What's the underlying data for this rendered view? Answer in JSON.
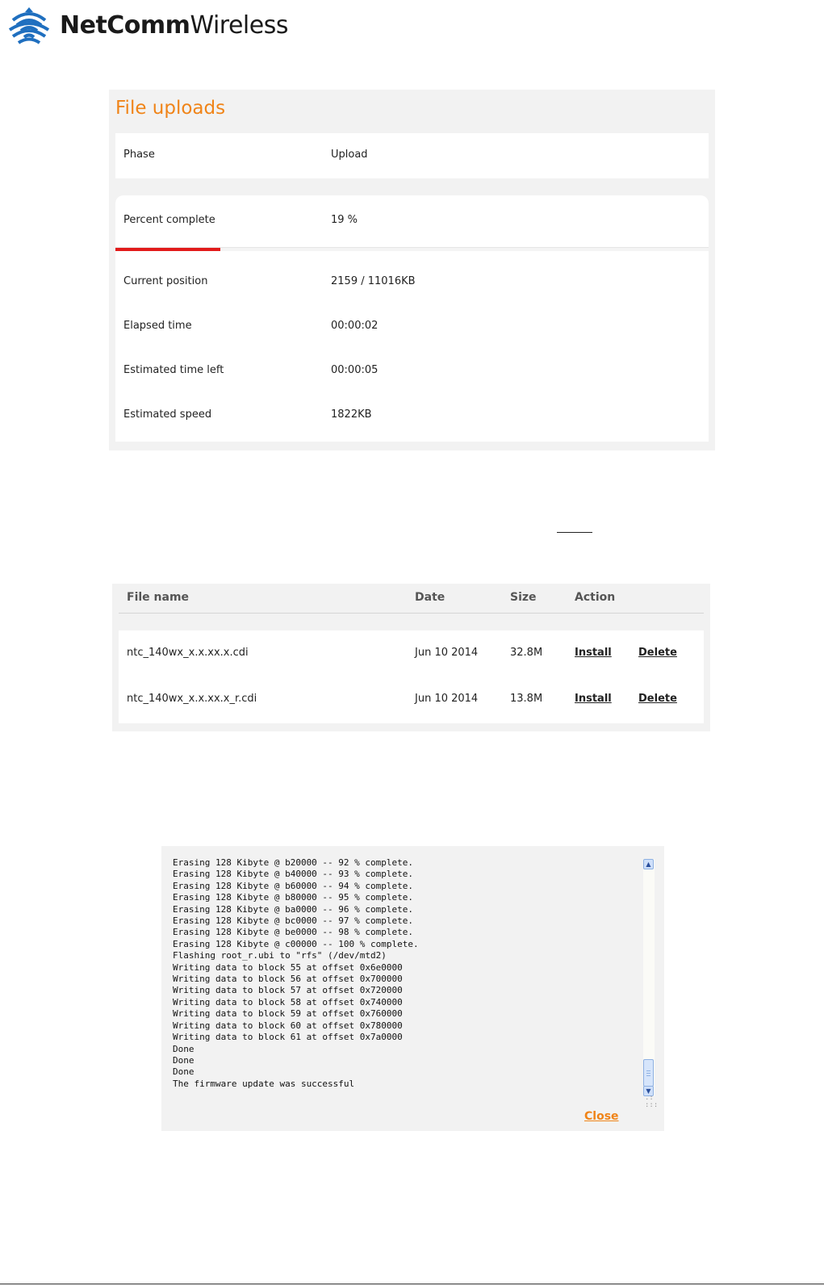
{
  "brand": {
    "logo_bold": "NetComm",
    "logo_light": "Wireless",
    "accent_color": "#f08418",
    "progress_color": "#e21b1b"
  },
  "upload": {
    "title": "File uploads",
    "phase_label": "Phase",
    "phase_value": "Upload",
    "percent_label": "Percent complete",
    "percent_value": "19 %",
    "percent_fraction": 0.19,
    "position_label": "Current position",
    "position_value": "2159 / 11016KB",
    "elapsed_label": "Elapsed time",
    "elapsed_value": "00:00:02",
    "left_label": "Estimated time left",
    "left_value": "00:00:05",
    "speed_label": "Estimated speed",
    "speed_value": "1822KB"
  },
  "files": {
    "headers": [
      "File name",
      "Date",
      "Size",
      "Action"
    ],
    "rows": [
      {
        "name": "ntc_140wx_x.x.xx.x.cdi",
        "date": "Jun 10 2014",
        "size": "32.8M",
        "install": "Install",
        "delete": "Delete"
      },
      {
        "name": "ntc_140wx_x.x.xx.x_r.cdi",
        "date": "Jun 10 2014",
        "size": "13.8M",
        "install": "Install",
        "delete": "Delete"
      }
    ]
  },
  "log": {
    "lines": [
      "Erasing 128 Kibyte @ b20000 -- 92 % complete.",
      "Erasing 128 Kibyte @ b40000 -- 93 % complete.",
      "Erasing 128 Kibyte @ b60000 -- 94 % complete.",
      "Erasing 128 Kibyte @ b80000 -- 95 % complete.",
      "Erasing 128 Kibyte @ ba0000 -- 96 % complete.",
      "Erasing 128 Kibyte @ bc0000 -- 97 % complete.",
      "Erasing 128 Kibyte @ be0000 -- 98 % complete.",
      "Erasing 128 Kibyte @ c00000 -- 100 % complete.",
      "Flashing root_r.ubi to \"rfs\" (/dev/mtd2)",
      "Writing data to block 55 at offset 0x6e0000",
      "Writing data to block 56 at offset 0x700000",
      "Writing data to block 57 at offset 0x720000",
      "Writing data to block 58 at offset 0x740000",
      "Writing data to block 59 at offset 0x760000",
      "Writing data to block 60 at offset 0x780000",
      "Writing data to block 61 at offset 0x7a0000",
      "Done",
      "Done",
      "Done",
      "The firmware update was successful"
    ],
    "close_label": "Close",
    "icons": [
      "scroll-up-icon",
      "scroll-down-icon",
      "resize-grip-icon"
    ]
  }
}
